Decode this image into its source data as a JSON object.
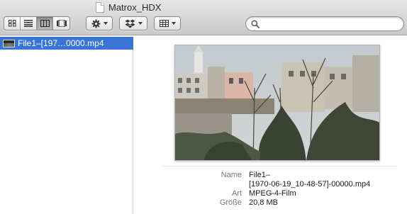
{
  "window": {
    "title": "Matrox_HDX"
  },
  "toolbar": {
    "view_buttons": [
      {
        "icon": "icon-view-icon",
        "active": false
      },
      {
        "icon": "list-view-icon",
        "active": false
      },
      {
        "icon": "column-view-icon",
        "active": true
      },
      {
        "icon": "cover-flow-icon",
        "active": false
      }
    ],
    "action_icon": "gear-icon",
    "dropbox_icon": "dropbox-icon",
    "arrange_icon": "arrange-grid-icon",
    "search": {
      "placeholder": "",
      "value": ""
    }
  },
  "sidebar": {
    "items": [
      {
        "label": "File1–[197…0000.mp4",
        "selected": true,
        "selected_color": "#3875d7"
      }
    ]
  },
  "preview": {
    "info": [
      {
        "key": "Name",
        "value": "File1–"
      },
      {
        "key": "",
        "value": "[1970-06-19_10-48-57]-00000.mp4"
      },
      {
        "key": "Art",
        "value": "MPEG-4-Film"
      },
      {
        "key": "Größe",
        "value": "20,8 MB"
      }
    ]
  }
}
